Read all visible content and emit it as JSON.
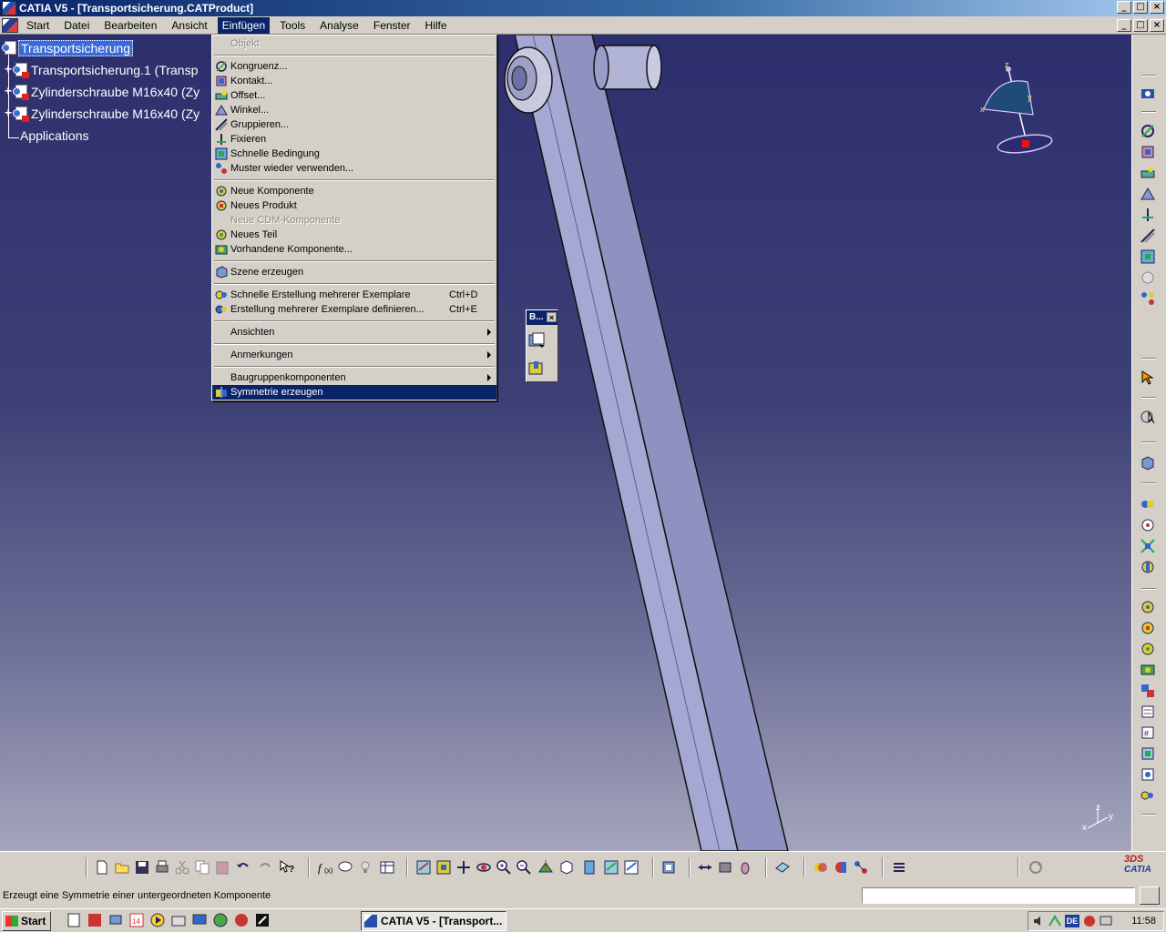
{
  "window": {
    "title": "CATIA V5 - [Transportsicherung.CATProduct]"
  },
  "menubar": {
    "items": [
      "Start",
      "Datei",
      "Bearbeiten",
      "Ansicht",
      "Einfügen",
      "Tools",
      "Analyse",
      "Fenster",
      "Hilfe"
    ],
    "active": "Einfügen"
  },
  "tree": {
    "root": "Transportsicherung",
    "children": [
      "Transportsicherung.1 (Transp",
      "Zylinderschraube M16x40 (Zy",
      "Zylinderschraube M16x40 (Zy"
    ],
    "applications": "Applications"
  },
  "insert_menu": {
    "objekt": "Objekt",
    "kongruenz": "Kongruenz...",
    "kontakt": "Kontakt...",
    "offset": "Offset...",
    "winkel": "Winkel...",
    "gruppieren": "Gruppieren...",
    "fixieren": "Fixieren",
    "schnelle_bedingung": "Schnelle Bedingung",
    "muster": "Muster wieder verwenden...",
    "neue_komponente": "Neue Komponente",
    "neues_produkt": "Neues Produkt",
    "neue_cdm": "Neue CDM-Komponente",
    "neues_teil": "Neues Teil",
    "vorhandene": "Vorhandene Komponente...",
    "szene": "Szene erzeugen",
    "schnelle_erstellung": "Schnelle Erstellung mehrerer Exemplare",
    "schnelle_erstellung_shortcut": "Ctrl+D",
    "erstellung_definieren": "Erstellung mehrerer Exemplare definieren...",
    "erstellung_definieren_shortcut": "Ctrl+E",
    "ansichten": "Ansichten",
    "anmerkungen": "Anmerkungen",
    "baugruppenkomponenten": "Baugruppenkomponenten",
    "symmetrie": "Symmetrie erzeugen"
  },
  "float_toolbar": {
    "title": "B...",
    "close": "×"
  },
  "compass_labels": {
    "z": "z",
    "x": "x",
    "y": "y"
  },
  "axis_labels": {
    "x": "x",
    "y": "y",
    "z": "z"
  },
  "bottom_toolbar": {
    "logo_text": "CATIA",
    "logo_mark": "3DS"
  },
  "statusbar": {
    "message": "Erzeugt eine Symmetrie einer untergeordneten Komponente",
    "command_value": ""
  },
  "taskbar": {
    "start": "Start",
    "task": "CATIA V5 - [Transport...",
    "lang": "DE",
    "clock": "11:58"
  },
  "colors": {
    "title_start": "#0a246a",
    "highlight": "#0a246a",
    "viewport_top": "#2d2f6e",
    "viewport_bottom": "#a4a5bc",
    "part_face": "#9fa2cc"
  }
}
